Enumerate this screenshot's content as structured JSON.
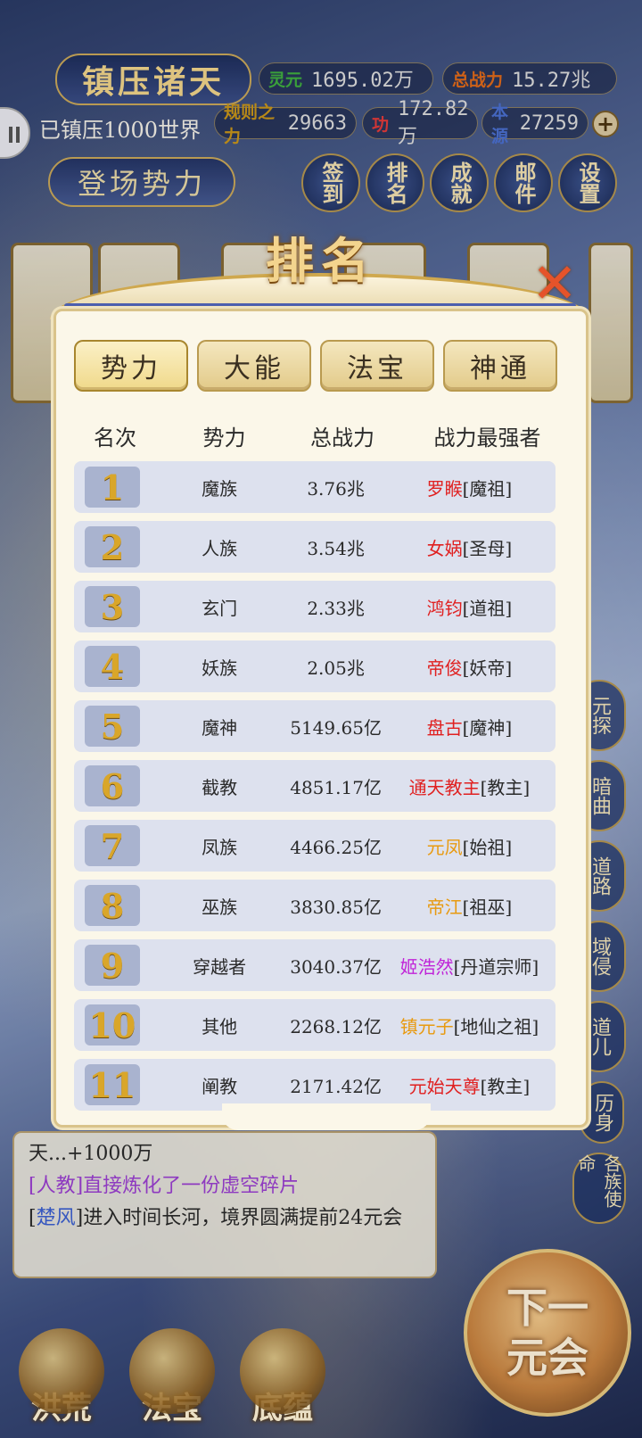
{
  "header": {
    "title": "镇压诸天",
    "subtitle": "已镇压1000世界",
    "enter_label": "登场势力",
    "stats": [
      {
        "key": "灵元",
        "value": "1695.02万",
        "color": "#3fae3f"
      },
      {
        "key": "总战力",
        "value": "15.27兆",
        "color": "#e06a1a"
      },
      {
        "key": "规则之力",
        "value": "29663",
        "color": "#c8951a"
      },
      {
        "key": "功",
        "value": "172.82万",
        "color": "#e23a3a"
      },
      {
        "key": "本源",
        "value": "27259",
        "color": "#4a6fd0"
      }
    ],
    "side_buttons": [
      "签到",
      "排名",
      "成就",
      "邮件",
      "设置"
    ]
  },
  "right_tags": [
    "元探",
    "暗曲",
    "道路",
    "域侵",
    "道儿",
    "历身"
  ],
  "modal": {
    "title": "排名",
    "tabs": [
      "势力",
      "大能",
      "法宝",
      "神通"
    ],
    "active_tab": 0,
    "columns": [
      "名次",
      "势力",
      "总战力",
      "战力最强者"
    ],
    "rows": [
      {
        "rank": "1",
        "faction": "魔族",
        "power": "3.76兆",
        "leader": "罗睺",
        "title": "[魔祖]",
        "color": "#e02020"
      },
      {
        "rank": "2",
        "faction": "人族",
        "power": "3.54兆",
        "leader": "女娲",
        "title": "[圣母]",
        "color": "#e02020"
      },
      {
        "rank": "3",
        "faction": "玄门",
        "power": "2.33兆",
        "leader": "鸿钧",
        "title": "[道祖]",
        "color": "#e02020"
      },
      {
        "rank": "4",
        "faction": "妖族",
        "power": "2.05兆",
        "leader": "帝俊",
        "title": "[妖帝]",
        "color": "#e02020"
      },
      {
        "rank": "5",
        "faction": "魔神",
        "power": "5149.65亿",
        "leader": "盘古",
        "title": "[魔神]",
        "color": "#e02020"
      },
      {
        "rank": "6",
        "faction": "截教",
        "power": "4851.17亿",
        "leader": "通天教主",
        "title": "[教主]",
        "color": "#e02020"
      },
      {
        "rank": "7",
        "faction": "凤族",
        "power": "4466.25亿",
        "leader": "元凤",
        "title": "[始祖]",
        "color": "#e89a10"
      },
      {
        "rank": "8",
        "faction": "巫族",
        "power": "3830.85亿",
        "leader": "帝江",
        "title": "[祖巫]",
        "color": "#e89a10"
      },
      {
        "rank": "9",
        "faction": "穿越者",
        "power": "3040.37亿",
        "leader": "姬浩然",
        "title": "[丹道宗师]",
        "color": "#c024d8"
      },
      {
        "rank": "10",
        "faction": "其他",
        "power": "2268.12亿",
        "leader": "镇元子",
        "title": "[地仙之祖]",
        "color": "#e89a10"
      },
      {
        "rank": "11",
        "faction": "阐教",
        "power": "2171.42亿",
        "leader": "元始天尊",
        "title": "[教主]",
        "color": "#e02020"
      }
    ]
  },
  "log": {
    "line1": "天...+1000万",
    "line2_prefix": "[人教]",
    "line2": "直接炼化了一份虚空碎片",
    "line3_name": "楚风",
    "line3": "进入时间长河，境界圆满提前24元会"
  },
  "bottom": {
    "buttons": [
      "洪荒",
      "法宝",
      "底蕴"
    ],
    "next_line1": "下一",
    "next_line2": "元会"
  }
}
